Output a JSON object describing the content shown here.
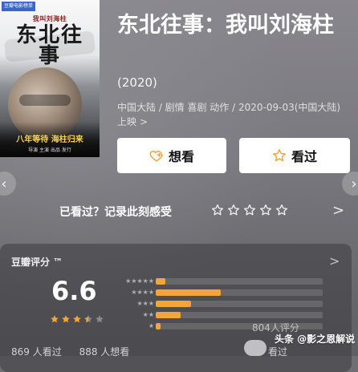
{
  "poster": {
    "badge": "豆瓣电影榜单",
    "subtitle": "我叫刘海柱",
    "title": "东北往事",
    "tagline": "八年等待 海柱归来",
    "small_text": "导演 主演 出品 发行"
  },
  "movie": {
    "title": "东北往事：我叫刘海柱",
    "year": "(2020)",
    "meta": "中国大陆 / 剧情 喜剧 动作 / 2020-09-03(中国大陆) 上映",
    "meta_chevron": ">"
  },
  "actions": {
    "wish_label": "想看",
    "seen_label": "看过"
  },
  "prompt": {
    "text": "已看过？记录此刻感受",
    "chevron": ">"
  },
  "rating": {
    "header": "豆瓣评分 ™",
    "header_chevron": ">",
    "score": "6.6",
    "stars_filled": 3.5,
    "distribution": [
      {
        "stars": 5,
        "fraction": 0.06
      },
      {
        "stars": 4,
        "fraction": 0.39
      },
      {
        "stars": 3,
        "fraction": 0.21
      },
      {
        "stars": 2,
        "fraction": 0.15
      },
      {
        "stars": 1,
        "fraction": 0.03
      }
    ],
    "count_text": "804人评分"
  },
  "bottom": {
    "watching": "869 人看过",
    "wanting": "888 人想看",
    "seen_short": "看过",
    "watermark": "头条 @影之恩解说"
  },
  "colors": {
    "accent_star": "#f3a43a",
    "white": "#ffffff"
  },
  "icons": {
    "wish_icon": "heart-plus-icon",
    "seen_icon": "star-outline-icon",
    "empty_star_icon": "star-outline-icon",
    "left_arrow_icon": "chevron-left-icon",
    "right_arrow_icon": "chevron-right-icon"
  }
}
